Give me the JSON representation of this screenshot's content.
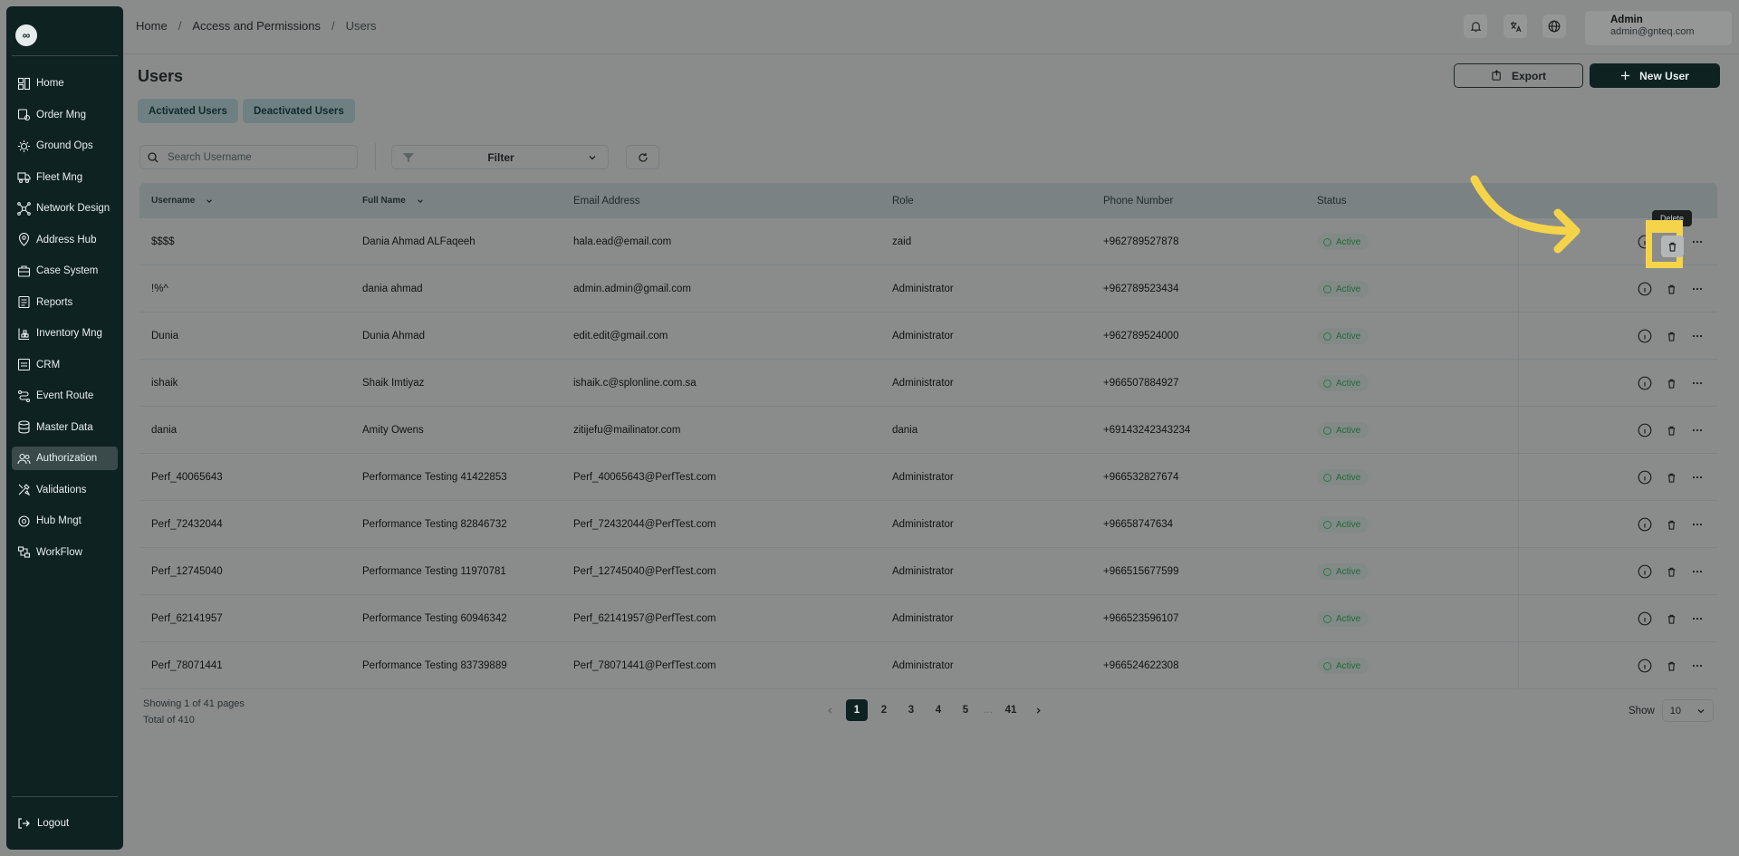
{
  "sidebar": {
    "logo_text": "∞",
    "items": [
      {
        "label": "Home",
        "icon": "home-icon"
      },
      {
        "label": "Order Mng",
        "icon": "order-icon"
      },
      {
        "label": "Ground Ops",
        "icon": "ground-ops-icon"
      },
      {
        "label": "Fleet Mng",
        "icon": "truck-icon"
      },
      {
        "label": "Network Design",
        "icon": "network-icon"
      },
      {
        "label": "Address Hub",
        "icon": "map-pin-icon"
      },
      {
        "label": "Case System",
        "icon": "case-icon"
      },
      {
        "label": "Reports",
        "icon": "report-icon"
      },
      {
        "label": "Inventory Mng",
        "icon": "inventory-icon"
      },
      {
        "label": "CRM",
        "icon": "crm-icon"
      },
      {
        "label": "Event Route",
        "icon": "route-icon"
      },
      {
        "label": "Master Data",
        "icon": "database-icon"
      },
      {
        "label": "Authorization",
        "icon": "users-icon",
        "active": true
      },
      {
        "label": "Validations",
        "icon": "tools-icon"
      },
      {
        "label": "Hub Mngt",
        "icon": "hub-icon"
      },
      {
        "label": "WorkFlow",
        "icon": "workflow-icon"
      }
    ],
    "logout": "Logout"
  },
  "breadcrumb": {
    "home": "Home",
    "section": "Access and Permissions",
    "current": "Users",
    "sep": "/"
  },
  "user": {
    "name": "Admin",
    "email": "admin@gnteq.com"
  },
  "page": {
    "title": "Users",
    "tabs": [
      "Activated Users",
      "Deactivated Users"
    ],
    "export_label": "Export",
    "new_user_label": "New User"
  },
  "filters": {
    "search_placeholder": "Search Username",
    "filter_label": "Filter"
  },
  "table": {
    "headers": [
      "Username",
      "Full Name",
      "Email Address",
      "Role",
      "Phone Number",
      "Status"
    ],
    "rows": [
      {
        "username": "$$$$",
        "full_name": "Dania Ahmad ALFaqeeh",
        "email": "hala.ead@email.com",
        "role": "zaid",
        "phone": "+962789527878",
        "status": "Active"
      },
      {
        "username": "!%^",
        "full_name": "dania ahmad",
        "email": "admin.admin@gmail.com",
        "role": "Administrator",
        "phone": "+962789523434",
        "status": "Active"
      },
      {
        "username": "Dunia",
        "full_name": "Dunia Ahmad",
        "email": "edit.edit@gmail.com",
        "role": "Administrator",
        "phone": "+962789524000",
        "status": "Active"
      },
      {
        "username": "ishaik",
        "full_name": "Shaik Imtiyaz",
        "email": "ishaik.c@splonline.com.sa",
        "role": "Administrator",
        "phone": "+966507884927",
        "status": "Active"
      },
      {
        "username": "dania",
        "full_name": "Amity Owens",
        "email": "zitijefu@mailinator.com",
        "role": "dania",
        "phone": "+69143242343234",
        "status": "Active"
      },
      {
        "username": "Perf_40065643",
        "full_name": "Performance Testing 41422853",
        "email": "Perf_40065643@PerfTest.com",
        "role": "Administrator",
        "phone": "+966532827674",
        "status": "Active"
      },
      {
        "username": "Perf_72432044",
        "full_name": "Performance Testing 82846732",
        "email": "Perf_72432044@PerfTest.com",
        "role": "Administrator",
        "phone": "+96658747634",
        "status": "Active"
      },
      {
        "username": "Perf_12745040",
        "full_name": "Performance Testing 11970781",
        "email": "Perf_12745040@PerfTest.com",
        "role": "Administrator",
        "phone": "+966515677599",
        "status": "Active"
      },
      {
        "username": "Perf_62141957",
        "full_name": "Performance Testing 60946342",
        "email": "Perf_62141957@PerfTest.com",
        "role": "Administrator",
        "phone": "+966523596107",
        "status": "Active"
      },
      {
        "username": "Perf_78071441",
        "full_name": "Performance Testing 83739889",
        "email": "Perf_78071441@PerfTest.com",
        "role": "Administrator",
        "phone": "+966524622308",
        "status": "Active"
      }
    ]
  },
  "pagination": {
    "showing": "Showing 1 of 41 pages",
    "total": "Total of 410",
    "pages": [
      "1",
      "2",
      "3",
      "4",
      "5",
      "...",
      "41"
    ],
    "show_label": "Show",
    "page_size": "10"
  },
  "tooltip": "Delete",
  "colors": {
    "accent": "#0f2222",
    "highlight": "#f5d44a",
    "status": "#2b7a47"
  }
}
